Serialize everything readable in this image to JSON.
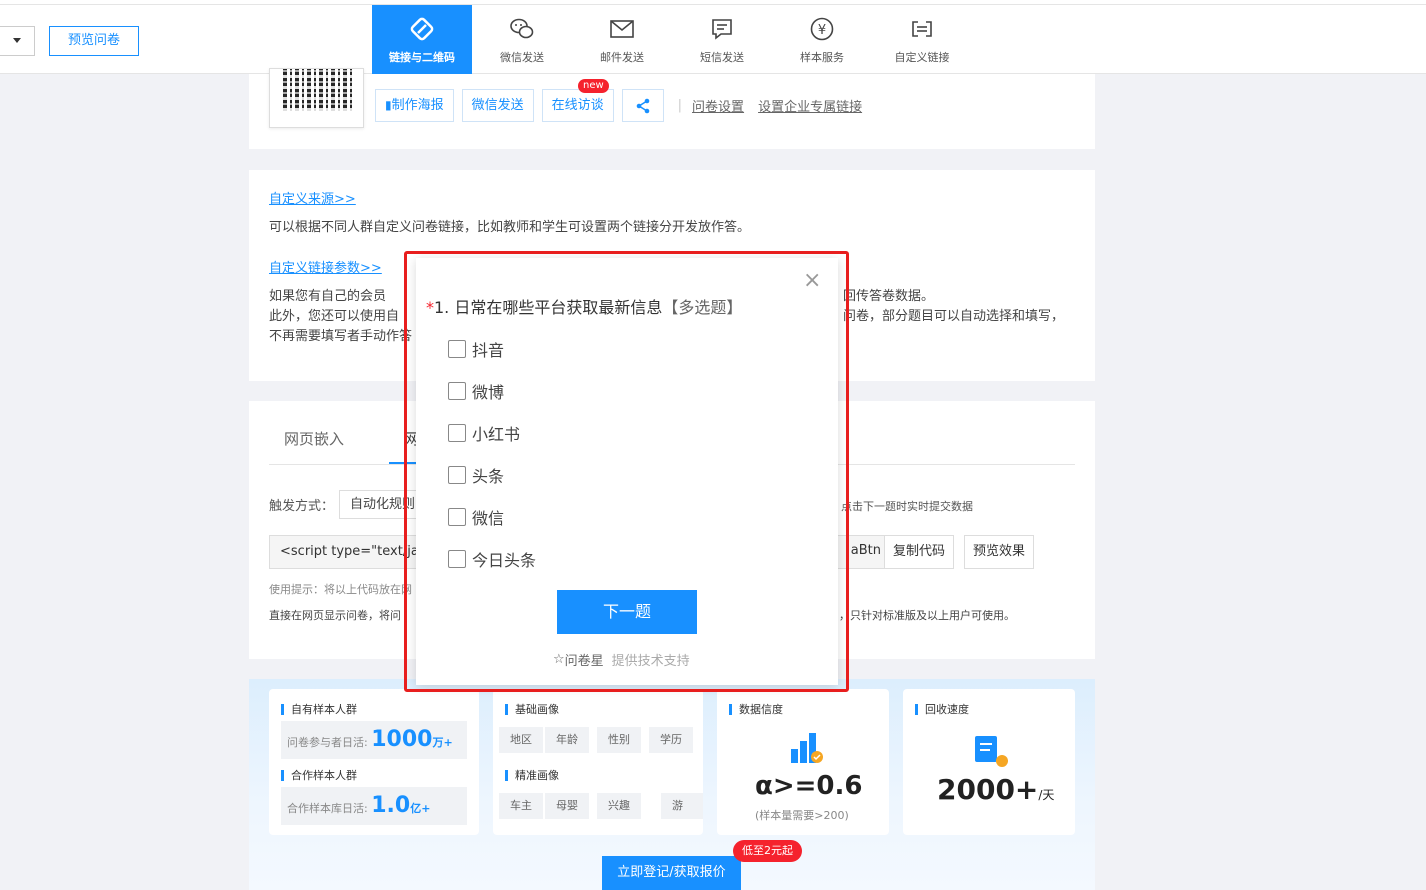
{
  "header": {
    "preview_label": "预览问卷",
    "nav": [
      {
        "label": "链接与二维码",
        "icon": "link-icon",
        "active": true
      },
      {
        "label": "微信发送",
        "icon": "wechat-icon",
        "active": false
      },
      {
        "label": "邮件发送",
        "icon": "mail-icon",
        "active": false
      },
      {
        "label": "短信发送",
        "icon": "sms-icon",
        "active": false
      },
      {
        "label": "样本服务",
        "icon": "yen-icon",
        "active": false
      },
      {
        "label": "自定义链接",
        "icon": "custom-link-icon",
        "active": false
      }
    ]
  },
  "share": {
    "poster": "制作海报",
    "wechat": "微信发送",
    "interview": "在线访谈",
    "new_badge": "new",
    "settings": "问卷设置",
    "custom_link": "设置企业专属链接"
  },
  "custom": {
    "source_link": "自定义来源>>",
    "source_desc": "可以根据不同人群自定义问卷链接，比如教师和学生可设置两个链接分开发放作答。",
    "param_link": "自定义链接参数>>",
    "param_desc_1a": "如果您有自己的会员",
    "param_desc_1b": "回传答卷数据。",
    "param_desc_2a": "此外，您还可以使用自",
    "param_desc_2b": "问卷，部分题目可以自动选择和填写，",
    "param_desc_3": "不再需要填写者手动作答"
  },
  "embed": {
    "tabs": [
      "网页嵌入",
      "网站集"
    ],
    "trigger_label": "触发方式：",
    "trigger_value": "自动化规则",
    "trigger_note": "点击下一题时实时提交数据",
    "code": "<script type=\"text/java",
    "code_tail": "aBtn",
    "copy": "复制代码",
    "preview": "预览效果",
    "hint": "使用提示：将以上代码放在网",
    "desc": "直接在网页显示问卷，将问",
    "desc_right": "，只针对标准版及以上用户可使用。"
  },
  "promo": {
    "own_sample": "自有样本人群",
    "own_daily": "问卷参与者日活:",
    "own_num": "1000",
    "own_unit": "万+",
    "partner_sample": "合作样本人群",
    "partner_daily": "合作样本库日活:",
    "partner_num": "1.0",
    "partner_unit": "亿+",
    "basic": "基础画像",
    "basic_tags": [
      "地区",
      "年龄",
      "性别",
      "学历"
    ],
    "precise": "精准画像",
    "precise_tags": [
      "车主",
      "母婴",
      "兴趣",
      "游戏"
    ],
    "reliability": "数据信度",
    "alpha": "α>=0.6",
    "alpha_note": "(样本量需要>200)",
    "speed": "回收速度",
    "speed_num": "2000+",
    "speed_unit": "/天",
    "cta": "立即登记/获取报价",
    "cta_badge": "低至2元起"
  },
  "modal": {
    "required_mark": "*",
    "number": "1.",
    "question": "日常在哪些平台获取最新信息",
    "type": "【多选题】",
    "options": [
      "抖音",
      "微博",
      "小红书",
      "头条",
      "微信",
      "今日头条"
    ],
    "next": "下一题",
    "brand": "问卷星",
    "support": "提供技术支持"
  }
}
